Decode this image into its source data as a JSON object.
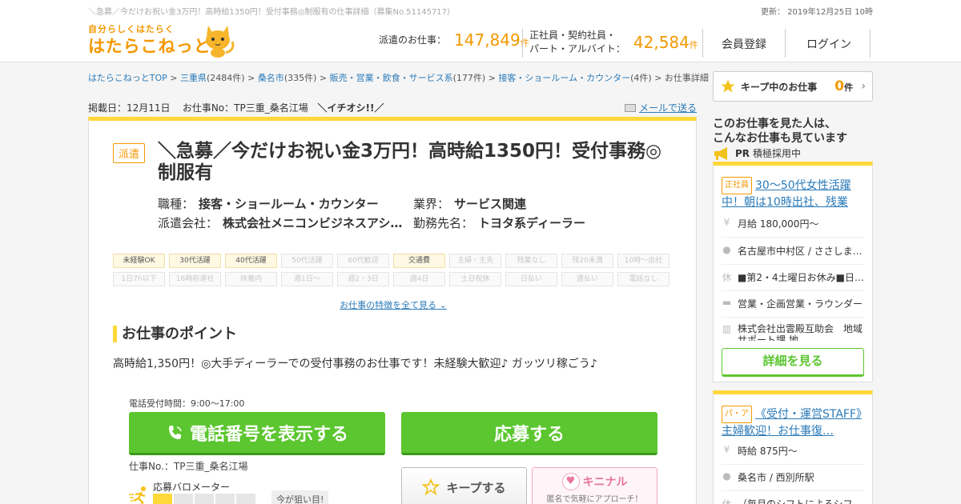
{
  "header": {
    "seo_text": "＼急募／今だけお祝い金3万円！高時給1350円！受付事務◎制服有の仕事詳細（募集No.51145717）",
    "updated": "更新： 2019年12月25日 10時",
    "logo_tagline": "自分らしくはたらく",
    "logo_text": "はたらこねっと",
    "haken_label": "派遣のお仕事：",
    "haken_count": "147,849",
    "unit": "件",
    "seishain_label_1": "正社員・契約社員・",
    "seishain_label_2": "パート・アルバイト：",
    "seishain_count": "42,584",
    "register": "会員登録",
    "login": "ログイン"
  },
  "breadcrumb": [
    {
      "label": "はたらこねっとTOP",
      "count": ""
    },
    {
      "label": "三重県",
      "count": "(2484件)"
    },
    {
      "label": "桑名市",
      "count": "(335件)"
    },
    {
      "label": "販売・営業・飲食・サービス系",
      "count": "(177件)"
    },
    {
      "label": "接客・ショールーム・カウンター",
      "count": "(4件)"
    },
    {
      "label": "お仕事詳細",
      "count": ""
    }
  ],
  "meta": {
    "posted": "掲載日：12月11日",
    "job_no": "お仕事No：TP三重_桑名江場",
    "tag": "＼イチオシ!!／",
    "mail": "メールで送る"
  },
  "job": {
    "type_badge": "派遣",
    "title": "＼急募／今だけお祝い金3万円！高時給1350円！受付事務◎制服有",
    "k1": "職種：",
    "v1": "接客・ショールーム・カウンター",
    "k2": "業界：",
    "v2": "サービス関連",
    "k3": "派遣会社：",
    "v3": "株式会社メニコンビジネスアシ…",
    "k4": "勤務先名：",
    "v4": "トヨタ系ディーラー",
    "tags": [
      {
        "label": "未経験OK",
        "on": true
      },
      {
        "label": "30代活躍",
        "on": true
      },
      {
        "label": "40代活躍",
        "on": true
      },
      {
        "label": "50代活躍",
        "on": false
      },
      {
        "label": "60代歓迎",
        "on": false
      },
      {
        "label": "交通費",
        "on": true
      },
      {
        "label": "主婦・主夫",
        "on": false
      },
      {
        "label": "残業なし",
        "on": false
      },
      {
        "label": "残20未満",
        "on": false
      },
      {
        "label": "10時～出社",
        "on": false
      },
      {
        "label": "1日7h以下",
        "on": false
      },
      {
        "label": "16時前退社",
        "on": false
      },
      {
        "label": "扶養内",
        "on": false
      },
      {
        "label": "週1日～",
        "on": false
      },
      {
        "label": "週2・3日",
        "on": false
      },
      {
        "label": "週4日",
        "on": false
      },
      {
        "label": "土日祝休",
        "on": false
      },
      {
        "label": "日払い",
        "on": false
      },
      {
        "label": "週払い",
        "on": false
      },
      {
        "label": "電話なし",
        "on": false
      }
    ],
    "all_features": "お仕事の特徴を全て見る",
    "point_heading": "お仕事のポイント",
    "point_text": "高時給1,350円！◎大手ディーラーでの受付事務のお仕事です！未経験大歓迎♪ ガッツリ稼ごう♪",
    "tel_hours": "電話受付時間：9:00～17:00",
    "tel_button": "電話番号を表示する",
    "apply_button": "応募する",
    "job_no_text": "仕事No.：TP三重_桑名江場",
    "meter_label": "応募バロメーター",
    "meter_level": 1,
    "meter_max": 5,
    "meter_note": "今が狙い目!",
    "keep_button": "キープする",
    "kinaru_title": "キニナル",
    "kinaru_sub": "匿名で気軽にアプローチ！"
  },
  "sidebar": {
    "keep_label": "キープ中のお仕事",
    "keep_count": "0",
    "keep_unit": "件",
    "heading_1": "このお仕事を見た人は、",
    "heading_2": "こんなお仕事も見ています",
    "pr": "PR",
    "pr_text": "積極採用中",
    "cards": [
      {
        "badge": "正社員",
        "title": "30～50代女性活躍中！朝は10時出社、残業",
        "salary": "月給 180,000円～",
        "place": "名古屋市中村区 / ささしま…",
        "holiday": "■第2・4土曜日お休み■日…",
        "category": "営業・企画営業・ラウンダー",
        "company": "株式会社出雲殿互助会　地域サポート課 地…",
        "detail_button": "詳細を見る"
      },
      {
        "badge": "パ・ア",
        "title": "《受付・運営STAFF》主婦歓迎！お仕事復…",
        "salary": "時給 875円～",
        "place": "桑名市 / 西別所駅",
        "holiday": "（毎月のシフトによるシフ…"
      }
    ]
  },
  "colors": {
    "accent": "#f39800",
    "green": "#5bc62f",
    "yellow": "#ffd83a",
    "link": "#2a7ab8"
  }
}
